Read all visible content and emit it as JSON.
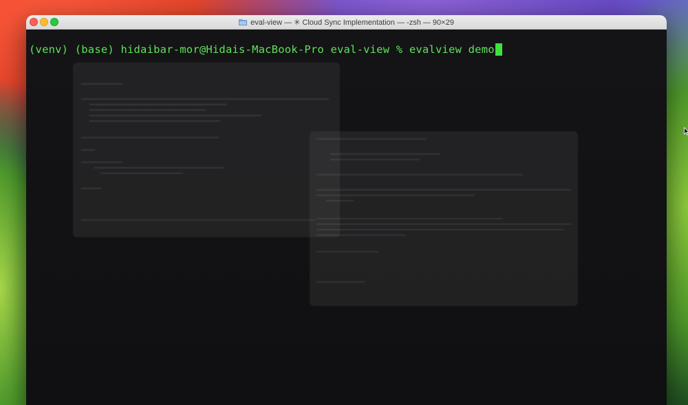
{
  "window": {
    "title": "eval-view — ✳ Cloud Sync Implementation — -zsh — 90×29",
    "folder_icon": "folder-icon"
  },
  "terminal": {
    "prompt": "(venv) (base) hidaibar-mor@Hidais-MacBook-Pro eval-view % ",
    "command": "evalview demo",
    "text_color": "#5fe35a",
    "cursor_color": "#3fe23b"
  },
  "colors": {
    "close": "#ff5f57",
    "minimize": "#febc2e",
    "maximize": "#28c840"
  }
}
